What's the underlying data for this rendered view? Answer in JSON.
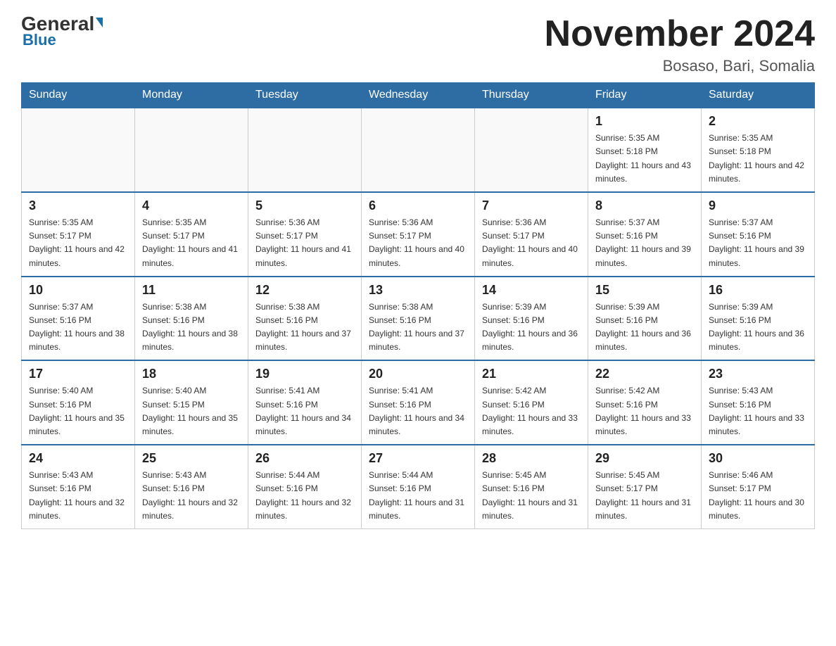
{
  "header": {
    "logo_general": "General",
    "logo_blue": "Blue",
    "month_title": "November 2024",
    "location": "Bosaso, Bari, Somalia"
  },
  "weekdays": [
    "Sunday",
    "Monday",
    "Tuesday",
    "Wednesday",
    "Thursday",
    "Friday",
    "Saturday"
  ],
  "weeks": [
    [
      {
        "day": "",
        "sunrise": "",
        "sunset": "",
        "daylight": ""
      },
      {
        "day": "",
        "sunrise": "",
        "sunset": "",
        "daylight": ""
      },
      {
        "day": "",
        "sunrise": "",
        "sunset": "",
        "daylight": ""
      },
      {
        "day": "",
        "sunrise": "",
        "sunset": "",
        "daylight": ""
      },
      {
        "day": "",
        "sunrise": "",
        "sunset": "",
        "daylight": ""
      },
      {
        "day": "1",
        "sunrise": "Sunrise: 5:35 AM",
        "sunset": "Sunset: 5:18 PM",
        "daylight": "Daylight: 11 hours and 43 minutes."
      },
      {
        "day": "2",
        "sunrise": "Sunrise: 5:35 AM",
        "sunset": "Sunset: 5:18 PM",
        "daylight": "Daylight: 11 hours and 42 minutes."
      }
    ],
    [
      {
        "day": "3",
        "sunrise": "Sunrise: 5:35 AM",
        "sunset": "Sunset: 5:17 PM",
        "daylight": "Daylight: 11 hours and 42 minutes."
      },
      {
        "day": "4",
        "sunrise": "Sunrise: 5:35 AM",
        "sunset": "Sunset: 5:17 PM",
        "daylight": "Daylight: 11 hours and 41 minutes."
      },
      {
        "day": "5",
        "sunrise": "Sunrise: 5:36 AM",
        "sunset": "Sunset: 5:17 PM",
        "daylight": "Daylight: 11 hours and 41 minutes."
      },
      {
        "day": "6",
        "sunrise": "Sunrise: 5:36 AM",
        "sunset": "Sunset: 5:17 PM",
        "daylight": "Daylight: 11 hours and 40 minutes."
      },
      {
        "day": "7",
        "sunrise": "Sunrise: 5:36 AM",
        "sunset": "Sunset: 5:17 PM",
        "daylight": "Daylight: 11 hours and 40 minutes."
      },
      {
        "day": "8",
        "sunrise": "Sunrise: 5:37 AM",
        "sunset": "Sunset: 5:16 PM",
        "daylight": "Daylight: 11 hours and 39 minutes."
      },
      {
        "day": "9",
        "sunrise": "Sunrise: 5:37 AM",
        "sunset": "Sunset: 5:16 PM",
        "daylight": "Daylight: 11 hours and 39 minutes."
      }
    ],
    [
      {
        "day": "10",
        "sunrise": "Sunrise: 5:37 AM",
        "sunset": "Sunset: 5:16 PM",
        "daylight": "Daylight: 11 hours and 38 minutes."
      },
      {
        "day": "11",
        "sunrise": "Sunrise: 5:38 AM",
        "sunset": "Sunset: 5:16 PM",
        "daylight": "Daylight: 11 hours and 38 minutes."
      },
      {
        "day": "12",
        "sunrise": "Sunrise: 5:38 AM",
        "sunset": "Sunset: 5:16 PM",
        "daylight": "Daylight: 11 hours and 37 minutes."
      },
      {
        "day": "13",
        "sunrise": "Sunrise: 5:38 AM",
        "sunset": "Sunset: 5:16 PM",
        "daylight": "Daylight: 11 hours and 37 minutes."
      },
      {
        "day": "14",
        "sunrise": "Sunrise: 5:39 AM",
        "sunset": "Sunset: 5:16 PM",
        "daylight": "Daylight: 11 hours and 36 minutes."
      },
      {
        "day": "15",
        "sunrise": "Sunrise: 5:39 AM",
        "sunset": "Sunset: 5:16 PM",
        "daylight": "Daylight: 11 hours and 36 minutes."
      },
      {
        "day": "16",
        "sunrise": "Sunrise: 5:39 AM",
        "sunset": "Sunset: 5:16 PM",
        "daylight": "Daylight: 11 hours and 36 minutes."
      }
    ],
    [
      {
        "day": "17",
        "sunrise": "Sunrise: 5:40 AM",
        "sunset": "Sunset: 5:16 PM",
        "daylight": "Daylight: 11 hours and 35 minutes."
      },
      {
        "day": "18",
        "sunrise": "Sunrise: 5:40 AM",
        "sunset": "Sunset: 5:15 PM",
        "daylight": "Daylight: 11 hours and 35 minutes."
      },
      {
        "day": "19",
        "sunrise": "Sunrise: 5:41 AM",
        "sunset": "Sunset: 5:16 PM",
        "daylight": "Daylight: 11 hours and 34 minutes."
      },
      {
        "day": "20",
        "sunrise": "Sunrise: 5:41 AM",
        "sunset": "Sunset: 5:16 PM",
        "daylight": "Daylight: 11 hours and 34 minutes."
      },
      {
        "day": "21",
        "sunrise": "Sunrise: 5:42 AM",
        "sunset": "Sunset: 5:16 PM",
        "daylight": "Daylight: 11 hours and 33 minutes."
      },
      {
        "day": "22",
        "sunrise": "Sunrise: 5:42 AM",
        "sunset": "Sunset: 5:16 PM",
        "daylight": "Daylight: 11 hours and 33 minutes."
      },
      {
        "day": "23",
        "sunrise": "Sunrise: 5:43 AM",
        "sunset": "Sunset: 5:16 PM",
        "daylight": "Daylight: 11 hours and 33 minutes."
      }
    ],
    [
      {
        "day": "24",
        "sunrise": "Sunrise: 5:43 AM",
        "sunset": "Sunset: 5:16 PM",
        "daylight": "Daylight: 11 hours and 32 minutes."
      },
      {
        "day": "25",
        "sunrise": "Sunrise: 5:43 AM",
        "sunset": "Sunset: 5:16 PM",
        "daylight": "Daylight: 11 hours and 32 minutes."
      },
      {
        "day": "26",
        "sunrise": "Sunrise: 5:44 AM",
        "sunset": "Sunset: 5:16 PM",
        "daylight": "Daylight: 11 hours and 32 minutes."
      },
      {
        "day": "27",
        "sunrise": "Sunrise: 5:44 AM",
        "sunset": "Sunset: 5:16 PM",
        "daylight": "Daylight: 11 hours and 31 minutes."
      },
      {
        "day": "28",
        "sunrise": "Sunrise: 5:45 AM",
        "sunset": "Sunset: 5:16 PM",
        "daylight": "Daylight: 11 hours and 31 minutes."
      },
      {
        "day": "29",
        "sunrise": "Sunrise: 5:45 AM",
        "sunset": "Sunset: 5:17 PM",
        "daylight": "Daylight: 11 hours and 31 minutes."
      },
      {
        "day": "30",
        "sunrise": "Sunrise: 5:46 AM",
        "sunset": "Sunset: 5:17 PM",
        "daylight": "Daylight: 11 hours and 30 minutes."
      }
    ]
  ]
}
